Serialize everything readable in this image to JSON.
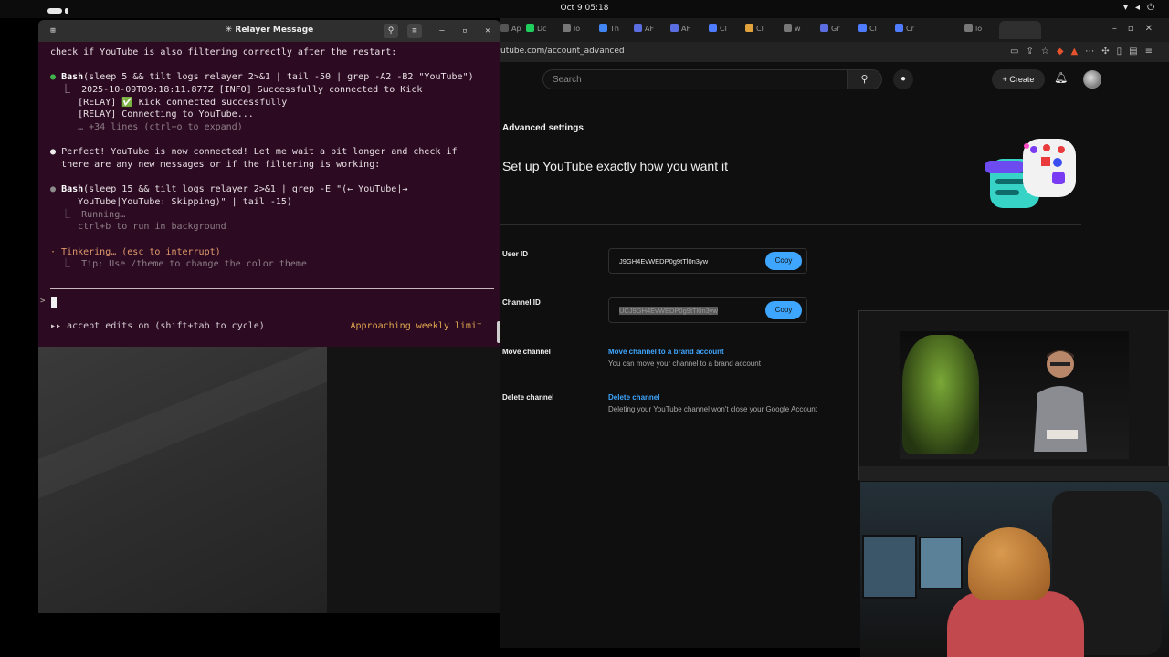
{
  "system_bar": {
    "clock": "Oct 9  05:18"
  },
  "terminal": {
    "title": "Relayer Message",
    "lines": [
      {
        "text": "check if YouTube is also filtering correctly after the restart:"
      },
      {
        "prefix": "Bash",
        "text": "(sleep 5 && tilt logs relayer 2>&1 | tail -50 | grep -A2 -B2 \"YouTube\")"
      },
      {
        "text": "  ⎿  2025-10-09T09:18:11.877Z [INFO] Successfully connected to Kick"
      },
      {
        "text": "     [RELAY] ✅ Kick connected successfully"
      },
      {
        "text": "     [RELAY] Connecting to YouTube..."
      },
      {
        "text": "     … +34 lines (ctrl+o to expand)"
      },
      {
        "text": "Perfect! YouTube is now connected! Let me wait a bit longer and check if"
      },
      {
        "text": "there are any new messages or if the filtering is working:"
      },
      {
        "prefix": "Bash",
        "text": "(sleep 15 && tilt logs relayer 2>&1 | grep -E \"(← YouTube|→"
      },
      {
        "text": "   YouTube|YouTube: Skipping)\" | tail -15)"
      },
      {
        "text": "  ⎿  Running…"
      },
      {
        "text": "     ctrl+b to run in background"
      },
      {
        "text": "· Tinkering… (esc to interrupt)"
      },
      {
        "text": "  ⎿  Tip: Use /theme to change the color theme"
      }
    ],
    "status_left": "▸▸ accept edits on (shift+tab to cycle)",
    "status_right": "Approaching weekly limit",
    "prompt": ">"
  },
  "browser": {
    "url": "utube.com/account_advanced",
    "tabs": [
      {
        "label": "Ap",
        "color": "#555555"
      },
      {
        "label": "Dc",
        "color": "#1fce5c"
      },
      {
        "label": "lo",
        "color": "#777777"
      },
      {
        "label": "Th",
        "color": "#4285f4"
      },
      {
        "label": "AF",
        "color": "#5b6ee1"
      },
      {
        "label": "AF",
        "color": "#5b6ee1"
      },
      {
        "label": "Cl",
        "color": "#4f7cff"
      },
      {
        "label": "Cl",
        "color": "#e2a23b"
      },
      {
        "label": "w",
        "color": "#777777"
      },
      {
        "label": "Gr",
        "color": "#5b6ee1"
      },
      {
        "label": "Cl",
        "color": "#4f7cff"
      },
      {
        "label": "Cr",
        "color": "#4f7cff"
      },
      {
        "label": "lo",
        "color": "#777777"
      }
    ]
  },
  "youtube": {
    "search_placeholder": "Search",
    "create_label": "Create",
    "page_heading": "Advanced settings",
    "page_subheading": "Set up YouTube exactly how you want it",
    "user_id_label": "User ID",
    "user_id_value": "J9GH4EvWEDP0g9tTl0n3yw",
    "channel_id_label": "Channel ID",
    "channel_id_value": "UCJ9GH4EvWEDP0g9tTl0n3yw",
    "copy_label": "Copy",
    "move_channel_label": "Move channel",
    "move_channel_link": "Move channel to a brand account",
    "move_channel_desc": "You can move your channel to a brand account",
    "delete_channel_label": "Delete channel",
    "delete_channel_link": "Delete channel",
    "delete_channel_desc": "Deleting your YouTube channel won't close your Google Account"
  },
  "colors": {
    "terminal_bg": "#2c0a22",
    "accent_blue": "#3ea6ff",
    "warning": "#e1a94f",
    "bullet_green": "#3fb24a"
  }
}
